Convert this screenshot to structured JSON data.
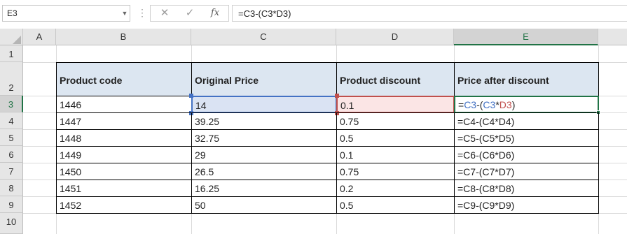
{
  "formula_bar": {
    "name_box": "E3",
    "name_box_dropdown_icon": "chevron-down-icon",
    "cancel_icon": "close-icon",
    "enter_icon": "check-icon",
    "fx_label": "fx",
    "formula": "=C3-(C3*D3)"
  },
  "columns": [
    "A",
    "B",
    "C",
    "D",
    "E"
  ],
  "selected_column": "E",
  "rows": [
    "1",
    "2",
    "3",
    "4",
    "5",
    "6",
    "7",
    "8",
    "9",
    "10"
  ],
  "selected_row": "3",
  "table": {
    "headers": [
      "Product code",
      "Original Price",
      "Product discount",
      "Price after discount"
    ],
    "rows": [
      [
        "1446",
        "14",
        "0.1",
        "=C3-(C3*D3)"
      ],
      [
        "1447",
        "39.25",
        "0.75",
        "=C4-(C4*D4)"
      ],
      [
        "1448",
        "32.75",
        "0.5",
        "=C5-(C5*D5)"
      ],
      [
        "1449",
        "29",
        "0.1",
        "=C6-(C6*D6)"
      ],
      [
        "1450",
        "26.5",
        "0.75",
        "=C7-(C7*D7)"
      ],
      [
        "1451",
        "16.25",
        "0.2",
        "=C8-(C8*D8)"
      ],
      [
        "1452",
        "50",
        "0.5",
        "=C9-(C9*D9)"
      ]
    ],
    "editing_formula_parts": [
      "=",
      "C3",
      "-(",
      "C3",
      "*",
      "D3",
      ")"
    ]
  },
  "colors": {
    "ref_blue": "#4472c4",
    "ref_red": "#c0504d",
    "selection_green": "#217346",
    "header_fill": "#dce6f1",
    "c3_fill": "#dae3f3",
    "d3_fill": "#fbe5e5"
  }
}
